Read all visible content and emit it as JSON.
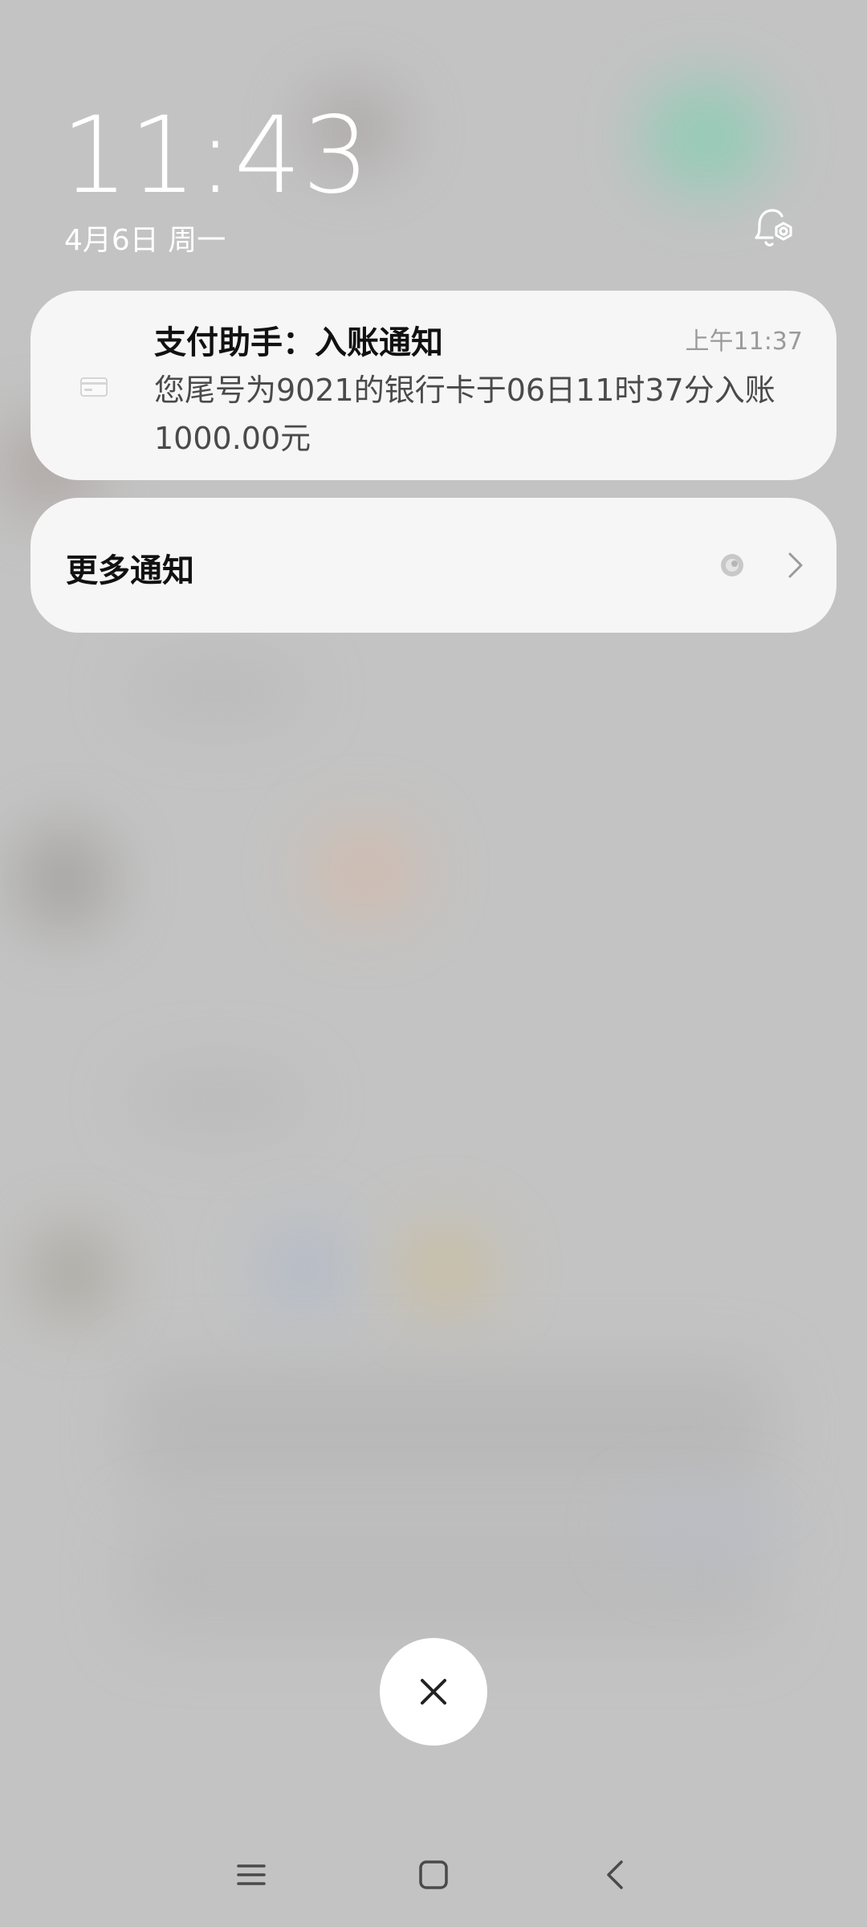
{
  "lockscreen": {
    "time": "11:43",
    "date": "4月6日  周一"
  },
  "notification": {
    "title": "支付助手：入账通知",
    "time": "上午11:37",
    "body": "您尾号为9021的银行卡于06日11时37分入账1000.00元",
    "icon": "bank-card-icon"
  },
  "more_notifications": {
    "label": "更多通知"
  },
  "icons": {
    "bell_settings": "bell-settings-icon",
    "close": "close-icon",
    "nav_menu": "menu-icon",
    "nav_home": "home-icon",
    "nav_back": "back-icon"
  },
  "colors": {
    "card_bg": "#f6f6f6",
    "background": "#c3c3c3",
    "title_text": "#111111",
    "body_text": "#4a4a4a",
    "time_text": "#9a9a9a"
  }
}
